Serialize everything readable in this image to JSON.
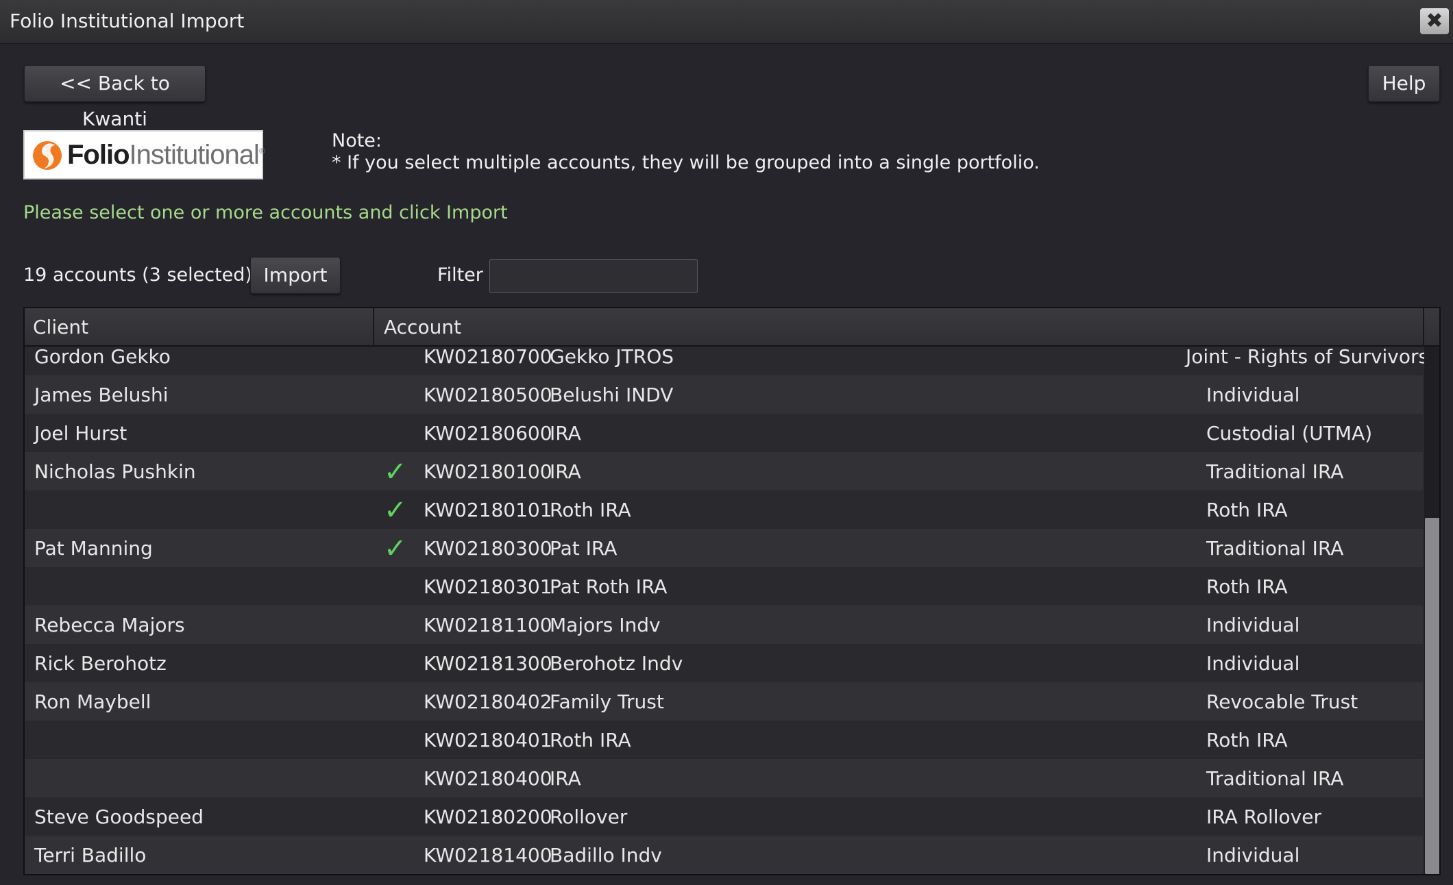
{
  "window": {
    "title": "Folio Institutional Import",
    "close_label": "✖"
  },
  "toolbar": {
    "back_label": "<< Back to Kwanti",
    "help_label": "Help"
  },
  "logo": {
    "text_bold": "Folio",
    "text_light": "Institutional",
    "trademark": "®"
  },
  "note": {
    "title": "Note:",
    "text": "* If you select multiple accounts, they will be grouped into a single portfolio."
  },
  "instruction": "Please select one or more accounts and click Import",
  "controls": {
    "count_text": "19 accounts (3 selected)",
    "import_label": "Import",
    "filter_label": "Filter",
    "filter_value": ""
  },
  "table": {
    "headers": {
      "client": "Client",
      "account": "Account"
    },
    "rows": [
      {
        "client": "Gordon Gekko",
        "checked": false,
        "account": "KW02180700",
        "name": "Gekko JTROS",
        "type": "Joint - Rights of Survivorship"
      },
      {
        "client": "James Belushi",
        "checked": false,
        "account": "KW02180500",
        "name": "Belushi INDV",
        "type": "Individual"
      },
      {
        "client": "Joel Hurst",
        "checked": false,
        "account": "KW02180600",
        "name": "IRA",
        "type": "Custodial (UTMA)"
      },
      {
        "client": "Nicholas Pushkin",
        "checked": true,
        "account": "KW02180100",
        "name": "IRA",
        "type": "Traditional IRA"
      },
      {
        "client": "",
        "checked": true,
        "account": "KW02180101",
        "name": "Roth IRA",
        "type": "Roth IRA"
      },
      {
        "client": "Pat Manning",
        "checked": true,
        "account": "KW02180300",
        "name": "Pat IRA",
        "type": "Traditional IRA"
      },
      {
        "client": "",
        "checked": false,
        "account": "KW02180301",
        "name": "Pat Roth IRA",
        "type": "Roth IRA"
      },
      {
        "client": "Rebecca Majors",
        "checked": false,
        "account": "KW02181100",
        "name": "Majors Indv",
        "type": "Individual"
      },
      {
        "client": "Rick Berohotz",
        "checked": false,
        "account": "KW02181300",
        "name": "Berohotz Indv",
        "type": "Individual"
      },
      {
        "client": "Ron Maybell",
        "checked": false,
        "account": "KW02180402",
        "name": "Family Trust",
        "type": "Revocable Trust"
      },
      {
        "client": "",
        "checked": false,
        "account": "KW02180401",
        "name": "Roth IRA",
        "type": "Roth IRA"
      },
      {
        "client": "",
        "checked": false,
        "account": "KW02180400",
        "name": "IRA",
        "type": "Traditional IRA"
      },
      {
        "client": "Steve Goodspeed",
        "checked": false,
        "account": "KW02180200",
        "name": "Rollover",
        "type": "IRA Rollover"
      },
      {
        "client": "Terri Badillo",
        "checked": false,
        "account": "KW02181400",
        "name": "Badillo Indv",
        "type": "Individual"
      }
    ],
    "check_glyph": "✓"
  },
  "colors": {
    "accent_green": "#a6d98a",
    "check_green": "#5fd35f",
    "background": "#25252b"
  }
}
